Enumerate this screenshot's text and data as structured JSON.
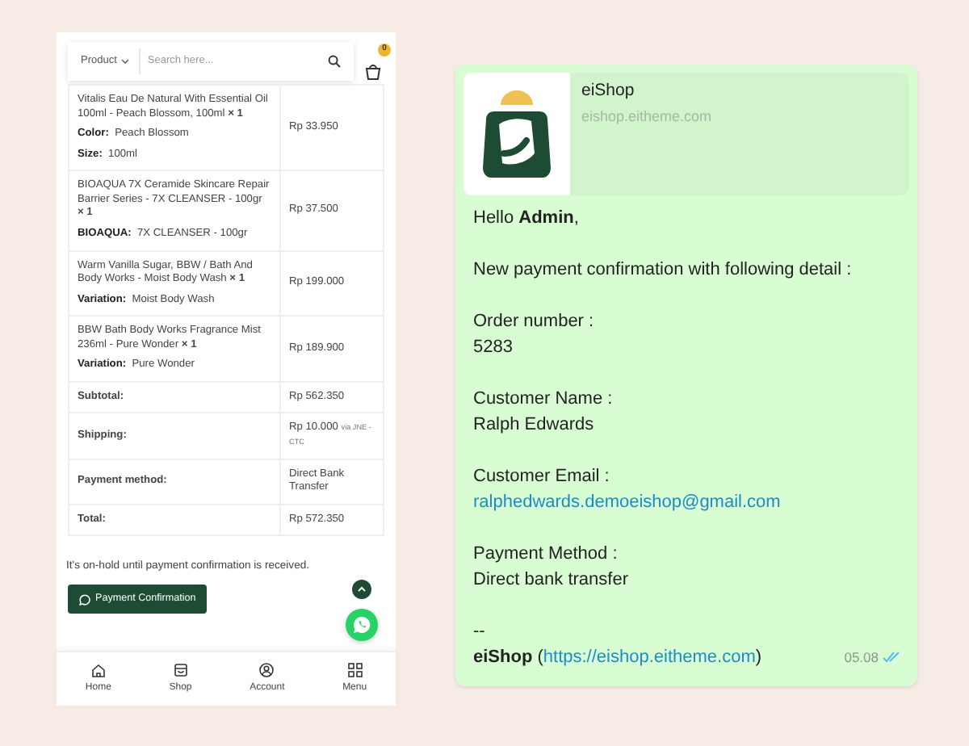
{
  "header": {
    "category": "Product",
    "search_placeholder": "Search here...",
    "cart_count": "0"
  },
  "order_items": [
    {
      "name": "Vitalis Eau De Natural With Essential Oil 100ml - Peach Blossom, 100ml **× 1**",
      "attributes": [
        {
          "label": "Color:",
          "value": "Peach Blossom"
        },
        {
          "label": "Size:",
          "value": "100ml"
        }
      ],
      "price": "Rp 33.950"
    },
    {
      "name": "BIOAQUA 7X Ceramide Skincare Repair Barrier Series - 7X CLEANSER - 100gr **× 1**",
      "attributes": [
        {
          "label": "BIOAQUA:",
          "value": "7X CLEANSER - 100gr"
        }
      ],
      "price": "Rp 37.500"
    },
    {
      "name": "Warm Vanilla Sugar, BBW / Bath And Body Works - Moist Body Wash **× 1**",
      "attributes": [
        {
          "label": "Variation:",
          "value": "Moist Body Wash"
        }
      ],
      "price": "Rp 199.000"
    },
    {
      "name": "BBW Bath Body Works Fragrance Mist 236ml - Pure Wonder **× 1**",
      "attributes": [
        {
          "label": "Variation:",
          "value": "Pure Wonder"
        }
      ],
      "price": "Rp 189.900"
    }
  ],
  "totals": [
    {
      "label": "Subtotal:",
      "value": "Rp 562.350"
    },
    {
      "label": "Shipping:",
      "value": "Rp 10.000",
      "note": "via JNE - CTC"
    },
    {
      "label": "Payment method:",
      "value": "Direct Bank Transfer"
    },
    {
      "label": "Total:",
      "value": "Rp 572.350"
    }
  ],
  "notice": "It's on-hold until payment confirmation is received.",
  "confirm_button": "Payment Confirmation",
  "bottom_nav": [
    {
      "label": "Home"
    },
    {
      "label": "Shop"
    },
    {
      "label": "Account"
    },
    {
      "label": "Menu"
    }
  ],
  "message": {
    "preview": {
      "title": "eiShop",
      "url": "eishop.eitheme.com"
    },
    "paragraphs": [
      [
        {
          "kind": "text",
          "text": "Hello **Admin**,"
        }
      ],
      [
        {
          "kind": "text",
          "text": "New payment confirmation with following detail :"
        }
      ],
      [
        {
          "kind": "text",
          "text": "Order number :"
        },
        {
          "kind": "text",
          "text": "5283"
        }
      ],
      [
        {
          "kind": "text",
          "text": "Customer Name :"
        },
        {
          "kind": "text",
          "text": "Ralph Edwards"
        }
      ],
      [
        {
          "kind": "text",
          "text": "Customer Email :"
        },
        {
          "kind": "link",
          "text": "ralphedwards.demoeishop@gmail.com"
        }
      ],
      [
        {
          "kind": "text",
          "text": "Payment Method :"
        },
        {
          "kind": "text",
          "text": "Direct bank transfer"
        }
      ]
    ],
    "separator": "--",
    "signature": {
      "before": "**eiShop** (",
      "link": "https://eishop.eitheme.com",
      "after": ")"
    },
    "time": "05.08",
    "read": true
  }
}
